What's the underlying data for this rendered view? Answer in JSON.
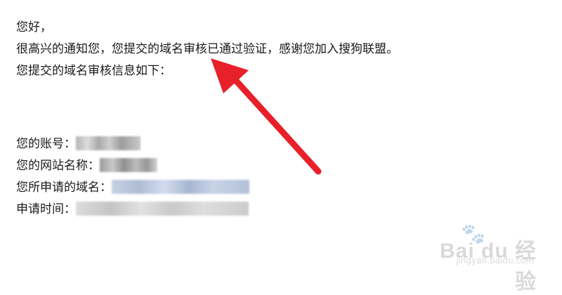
{
  "email": {
    "greeting": "您好，",
    "message": "很高兴的通知您，您提交的域名审核已通过验证，感谢您加入搜狗联盟。",
    "info_intro": "您提交的域名审核信息如下：",
    "fields": [
      {
        "label": "您的账号："
      },
      {
        "label": "您的网站名称："
      },
      {
        "label": "您所申请的域名："
      },
      {
        "label": "申请时间："
      }
    ]
  },
  "annotation": {
    "arrow_color": "#e8202a"
  },
  "watermark": {
    "logo_text": "Bai du 经验",
    "url": "jingyan.baidu.com",
    "icon": "paw-icon"
  }
}
